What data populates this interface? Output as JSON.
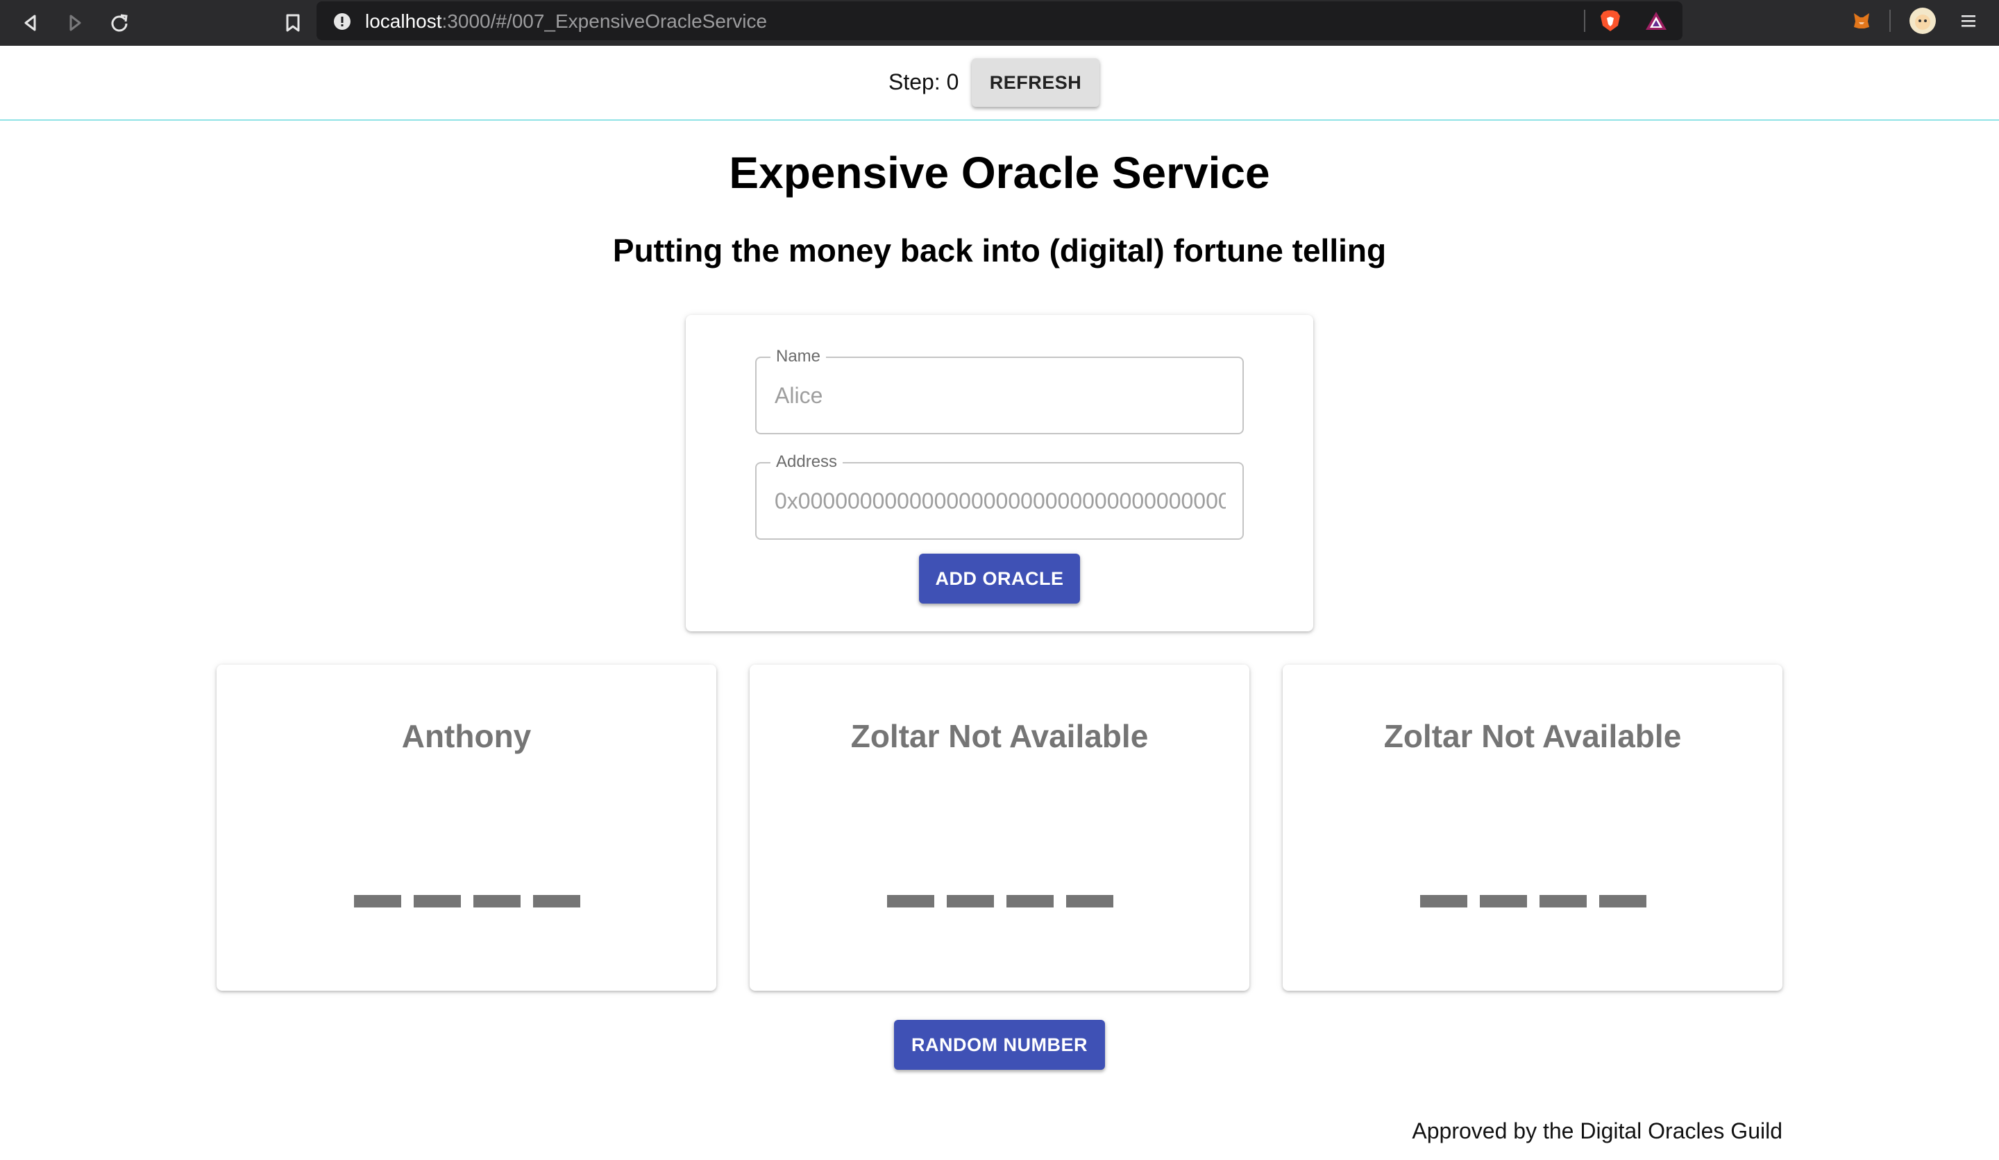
{
  "browser": {
    "url_host": "localhost",
    "url_path": ":3000/#/007_ExpensiveOracleService"
  },
  "stepbar": {
    "step_text": "Step: 0",
    "refresh_label": "REFRESH"
  },
  "header": {
    "title": "Expensive Oracle Service",
    "subtitle": "Putting the money back into (digital) fortune telling"
  },
  "form": {
    "name_label": "Name",
    "name_placeholder": "Alice",
    "address_label": "Address",
    "address_placeholder": "0x0000000000000000000000000000000000000000",
    "add_label": "ADD ORACLE"
  },
  "oracles": [
    {
      "name": "Anthony"
    },
    {
      "name": "Zoltar Not Available"
    },
    {
      "name": "Zoltar Not Available"
    }
  ],
  "random_label": "RANDOM NUMBER",
  "footer": "Approved by the Digital Oracles Guild",
  "colors": {
    "primary": "#3f51b5",
    "refresh_bg": "#e0e0e0",
    "oracle_text": "#757575",
    "divider": "#8fe3e6"
  }
}
